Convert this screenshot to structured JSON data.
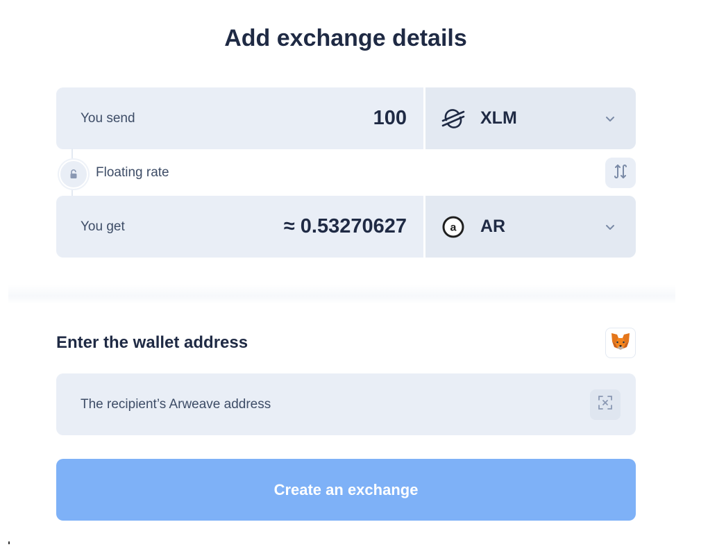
{
  "page": {
    "title": "Add exchange details"
  },
  "send": {
    "label": "You send",
    "amount": "100",
    "currency": "XLM",
    "currency_icon": "stellar-icon"
  },
  "rate": {
    "label": "Floating rate",
    "lock_icon": "unlock-icon",
    "swap_icon": "swap-icon"
  },
  "get": {
    "label": "You get",
    "amount": "≈ 0.53270627",
    "currency": "AR",
    "currency_icon": "arweave-icon"
  },
  "wallet": {
    "title": "Enter the wallet address",
    "placeholder": "The recipient’s Arweave address",
    "wallet_icon": "metamask-icon",
    "scan_icon": "qr-scan-icon"
  },
  "actions": {
    "create_label": "Create an exchange"
  },
  "colors": {
    "field_bg": "#e9eef6",
    "currency_bg": "#e3e9f2",
    "primary_disabled": "#7eb1f7",
    "text": "#1f2a44"
  }
}
